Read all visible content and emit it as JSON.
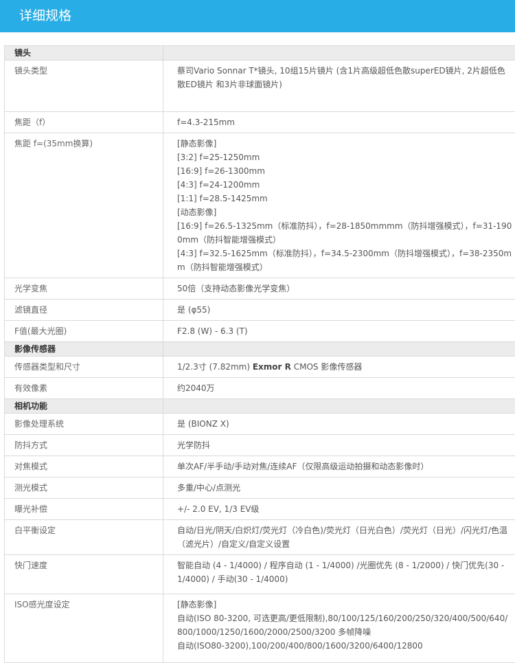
{
  "header": {
    "title": "详细规格"
  },
  "sections": [
    {
      "title": "镜头",
      "rows": [
        {
          "label": "镜头类型",
          "lines": [
            "蔡司Vario Sonnar T*镜头, 10组15片镜片 (含1片高级超低色散superED镜片, 2片超低色散ED镜片 和3片非球面镜片)"
          ]
        },
        {
          "label": "焦距（f）",
          "lines": [
            "f=4.3-215mm"
          ]
        },
        {
          "label": "焦距 f=(35mm换算)",
          "lines": [
            "[静态影像]",
            "[3:2] f=25-1250mm",
            "[16:9] f=26-1300mm",
            "[4:3] f=24-1200mm",
            "[1:1] f=28.5-1425mm",
            "[动态影像]",
            "[16:9] f=26.5-1325mm（标准防抖），f=28-1850mmmm（防抖增强模式），f=31-1900mm（防抖智能增强模式）",
            "[4:3] f=32.5-1625mm（标准防抖），f=34.5-2300mm（防抖增强模式），f=38-2350mm（防抖智能增强模式）"
          ]
        },
        {
          "label": "光学变焦",
          "lines": [
            "50倍（支持动态影像光学变焦）"
          ]
        },
        {
          "label": "滤镜直径",
          "lines": [
            "是 (φ55)"
          ]
        },
        {
          "label": "F值(最大光圈)",
          "lines": [
            "F2.8 (W) - 6.3 (T)"
          ]
        }
      ]
    },
    {
      "title": "影像传感器",
      "rows": [
        {
          "label": "传感器类型和尺寸",
          "value_pre": "1/2.3寸 (7.82mm) ",
          "value_strong": "Exmor R",
          "value_post": " CMOS 影像传感器"
        },
        {
          "label": "有效像素",
          "lines": [
            "约2040万"
          ]
        }
      ]
    },
    {
      "title": "相机功能",
      "rows": [
        {
          "label": "影像处理系统",
          "lines": [
            "是 (BIONZ X)"
          ]
        },
        {
          "label": "防抖方式",
          "lines": [
            "光学防抖"
          ]
        },
        {
          "label": "对焦模式",
          "lines": [
            "单次AF/半手动/手动对焦/连续AF（仅限高级运动拍摄和动态影像时）"
          ]
        },
        {
          "label": "测光模式",
          "lines": [
            "多重/中心/点测光"
          ]
        },
        {
          "label": "曝光补偿",
          "lines": [
            "+/- 2.0 EV, 1/3 EV级"
          ]
        },
        {
          "label": "白平衡设定",
          "lines": [
            "自动/日光/阴天/白炽灯/荧光灯（冷白色)/荧光灯（日光白色）/荧光灯（日光）/闪光灯/色温（滤光片）/自定义/自定义设置"
          ]
        },
        {
          "label": "快门速度",
          "lines": [
            "智能自动 (4 - 1/4000) / 程序自动 (1 - 1/4000) /光圈优先 (8 - 1/2000) / 快门优先(30 - 1/4000) / 手动(30 - 1/4000)"
          ]
        },
        {
          "label": "ISO感光度设定",
          "lines": [
            "[静态影像]",
            "自动(ISO 80-3200, 可选更高/更低限制),80/100/125/160/200/250/320/400/500/640/800/1000/1250/1600/2000/2500/3200 多帧降噪",
            "自动(ISO80-3200),100/200/400/800/1600/3200/6400/12800"
          ]
        }
      ]
    }
  ]
}
